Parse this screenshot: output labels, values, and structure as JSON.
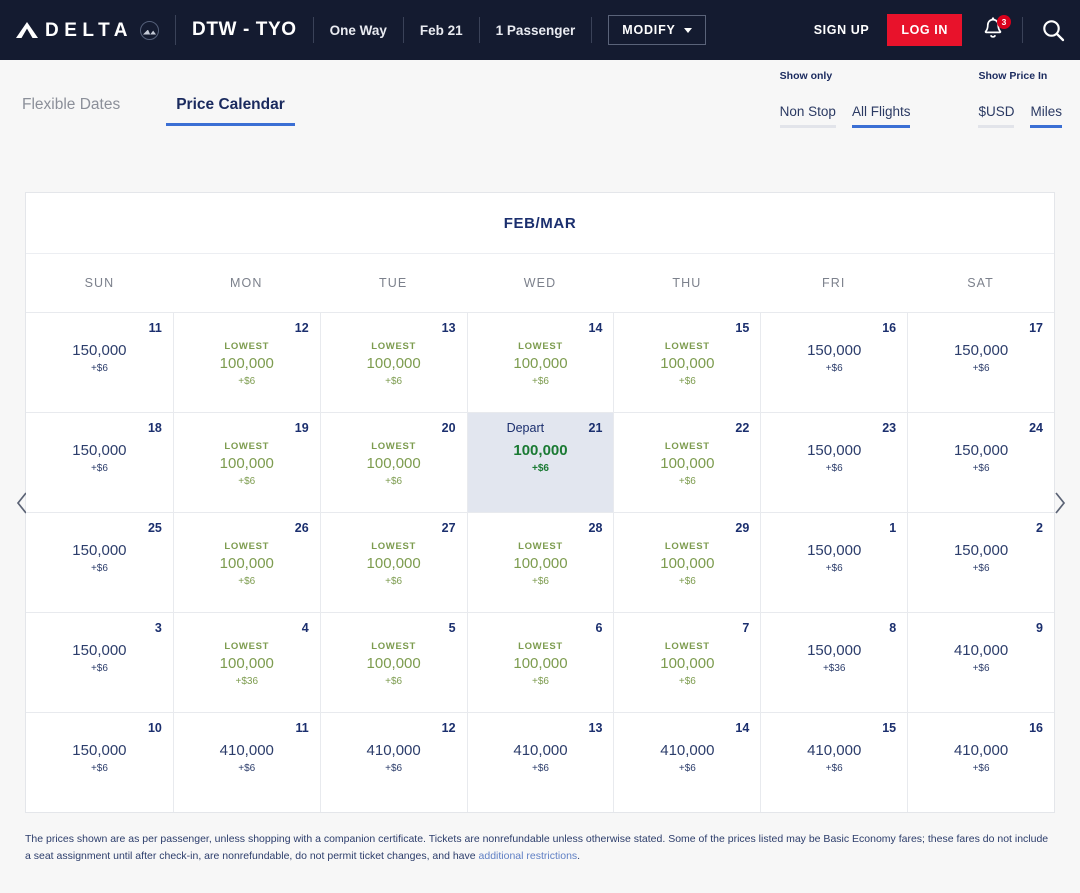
{
  "header": {
    "brand": "DELTA",
    "logo_icon": "delta-widget-triangle-icon",
    "skymiles_icon": "skymiles-badge-icon",
    "route": "DTW - TYO",
    "trip_type": "One Way",
    "date": "Feb 21",
    "passengers": "1 Passenger",
    "modify_label": "MODIFY",
    "signup_label": "SIGN UP",
    "login_label": "LOG IN",
    "notification_count": "3",
    "bell_icon": "notification-bell-icon",
    "search_icon": "search-icon",
    "accent_red": "#e8122b",
    "bar_bg": "#141b30"
  },
  "tabs": [
    {
      "label": "Flexible Dates",
      "active": false
    },
    {
      "label": "Price Calendar",
      "active": true
    }
  ],
  "filters": [
    {
      "label": "Show only",
      "options": [
        {
          "label": "Non Stop",
          "active": false
        },
        {
          "label": "All Flights",
          "active": true
        }
      ]
    },
    {
      "label": "Show Price In",
      "options": [
        {
          "label": "$USD",
          "active": false
        },
        {
          "label": "Miles",
          "active": true
        }
      ]
    }
  ],
  "calendar": {
    "title": "FEB/MAR",
    "prev_icon": "chevron-left-icon",
    "next_icon": "chevron-right-icon",
    "weekdays": [
      "SUN",
      "MON",
      "TUE",
      "WED",
      "THU",
      "FRI",
      "SAT"
    ],
    "lowest_label": "LOWEST",
    "depart_label": "Depart",
    "accent_blue": "#3b6fd4",
    "lowest_green": "#7d9c4f",
    "selected_green": "#1a7a33",
    "selected_bg": "#e2e6ef",
    "cells": [
      {
        "day": "11",
        "price": "150,000",
        "tax": "+$6",
        "lowest": false,
        "selected": false
      },
      {
        "day": "12",
        "price": "100,000",
        "tax": "+$6",
        "lowest": true,
        "selected": false
      },
      {
        "day": "13",
        "price": "100,000",
        "tax": "+$6",
        "lowest": true,
        "selected": false
      },
      {
        "day": "14",
        "price": "100,000",
        "tax": "+$6",
        "lowest": true,
        "selected": false
      },
      {
        "day": "15",
        "price": "100,000",
        "tax": "+$6",
        "lowest": true,
        "selected": false
      },
      {
        "day": "16",
        "price": "150,000",
        "tax": "+$6",
        "lowest": false,
        "selected": false
      },
      {
        "day": "17",
        "price": "150,000",
        "tax": "+$6",
        "lowest": false,
        "selected": false
      },
      {
        "day": "18",
        "price": "150,000",
        "tax": "+$6",
        "lowest": false,
        "selected": false
      },
      {
        "day": "19",
        "price": "100,000",
        "tax": "+$6",
        "lowest": true,
        "selected": false
      },
      {
        "day": "20",
        "price": "100,000",
        "tax": "+$6",
        "lowest": true,
        "selected": false
      },
      {
        "day": "21",
        "price": "100,000",
        "tax": "+$6",
        "lowest": false,
        "selected": true
      },
      {
        "day": "22",
        "price": "100,000",
        "tax": "+$6",
        "lowest": true,
        "selected": false
      },
      {
        "day": "23",
        "price": "150,000",
        "tax": "+$6",
        "lowest": false,
        "selected": false
      },
      {
        "day": "24",
        "price": "150,000",
        "tax": "+$6",
        "lowest": false,
        "selected": false
      },
      {
        "day": "25",
        "price": "150,000",
        "tax": "+$6",
        "lowest": false,
        "selected": false
      },
      {
        "day": "26",
        "price": "100,000",
        "tax": "+$6",
        "lowest": true,
        "selected": false
      },
      {
        "day": "27",
        "price": "100,000",
        "tax": "+$6",
        "lowest": true,
        "selected": false
      },
      {
        "day": "28",
        "price": "100,000",
        "tax": "+$6",
        "lowest": true,
        "selected": false
      },
      {
        "day": "29",
        "price": "100,000",
        "tax": "+$6",
        "lowest": true,
        "selected": false
      },
      {
        "day": "1",
        "price": "150,000",
        "tax": "+$6",
        "lowest": false,
        "selected": false
      },
      {
        "day": "2",
        "price": "150,000",
        "tax": "+$6",
        "lowest": false,
        "selected": false
      },
      {
        "day": "3",
        "price": "150,000",
        "tax": "+$6",
        "lowest": false,
        "selected": false
      },
      {
        "day": "4",
        "price": "100,000",
        "tax": "+$36",
        "lowest": true,
        "selected": false
      },
      {
        "day": "5",
        "price": "100,000",
        "tax": "+$6",
        "lowest": true,
        "selected": false
      },
      {
        "day": "6",
        "price": "100,000",
        "tax": "+$6",
        "lowest": true,
        "selected": false
      },
      {
        "day": "7",
        "price": "100,000",
        "tax": "+$6",
        "lowest": true,
        "selected": false
      },
      {
        "day": "8",
        "price": "150,000",
        "tax": "+$36",
        "lowest": false,
        "selected": false
      },
      {
        "day": "9",
        "price": "410,000",
        "tax": "+$6",
        "lowest": false,
        "selected": false
      },
      {
        "day": "10",
        "price": "150,000",
        "tax": "+$6",
        "lowest": false,
        "selected": false
      },
      {
        "day": "11",
        "price": "410,000",
        "tax": "+$6",
        "lowest": false,
        "selected": false
      },
      {
        "day": "12",
        "price": "410,000",
        "tax": "+$6",
        "lowest": false,
        "selected": false
      },
      {
        "day": "13",
        "price": "410,000",
        "tax": "+$6",
        "lowest": false,
        "selected": false
      },
      {
        "day": "14",
        "price": "410,000",
        "tax": "+$6",
        "lowest": false,
        "selected": false
      },
      {
        "day": "15",
        "price": "410,000",
        "tax": "+$6",
        "lowest": false,
        "selected": false
      },
      {
        "day": "16",
        "price": "410,000",
        "tax": "+$6",
        "lowest": false,
        "selected": false
      }
    ]
  },
  "footer": {
    "text": "The prices shown are as per passenger, unless shopping with a companion certificate. Tickets are nonrefundable unless otherwise stated. Some of the prices listed may be Basic Economy fares; these fares do not include a seat assignment until after check-in, are nonrefundable, do not permit ticket changes, and have ",
    "link": "additional restrictions",
    "tail": "."
  }
}
